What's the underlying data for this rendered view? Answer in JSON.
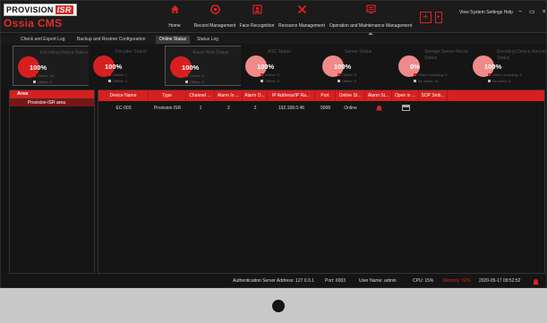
{
  "app": {
    "logo_text": "PROVISION",
    "logo_badge": "ISR",
    "logo_subtitle": "Ossia CMS"
  },
  "modules": [
    {
      "label": "Home",
      "icon": "home-icon"
    },
    {
      "label": "Record Management",
      "icon": "record-icon"
    },
    {
      "label": "Face Recognition",
      "icon": "face-recognition-icon"
    },
    {
      "label": "Resource Management",
      "icon": "tools-icon"
    },
    {
      "label": "Operation and Maintenance Management",
      "icon": "monitor-icon"
    }
  ],
  "header": {
    "plus_label": "+",
    "arrow_label": "▸",
    "sys_menu": "View System Settings Help",
    "win_controls": "− ▭ ×"
  },
  "tabs": [
    {
      "label": "Check and Export Log"
    },
    {
      "label": "Backup and Restore Configuration"
    },
    {
      "label": "Online Status",
      "active": true
    },
    {
      "label": "Status Log"
    }
  ],
  "cards": [
    {
      "title": "Encoding Device Status",
      "percent": "100%",
      "l1": "Online: 16",
      "l2": "Offline: 0",
      "color": "#d81f1f"
    },
    {
      "title": "Decoder Status",
      "percent": "100%",
      "l1": "Online: 1",
      "l2": "Offline: 0",
      "color": "#d81f1f"
    },
    {
      "title": "Alarm Host Status",
      "percent": "100%",
      "l1": "Online: 0",
      "l2": "Offline: 0",
      "color": "#d81f1f"
    },
    {
      "title": "ASC Status",
      "percent": "100%",
      "l1": "Online: 0",
      "l2": "Offline: 0",
      "color": "#ef8a8a"
    },
    {
      "title": "Server Status",
      "percent": "100%",
      "l1": "Online: 0",
      "l2": "Offline: 0",
      "color": "#ef8a8a"
    },
    {
      "title": "Storage Server Record Status",
      "percent": "0%",
      "l1": "Video recording: 0",
      "l2": "No video: 10",
      "color": "#ef8a8a"
    },
    {
      "title": "Encoding Device Record Status",
      "percent": "100%",
      "l1": "Video recording: 0",
      "l2": "No video: 0",
      "color": "#ef8a8a"
    }
  ],
  "area_panel": {
    "header": "Area",
    "items": [
      "Provision-ISR area"
    ]
  },
  "table": {
    "columns": [
      "Device Name",
      "Type",
      "Channel ...",
      "Alarm In ...",
      "Alarm O...",
      "IP Address/IP Ra...",
      "Port",
      "Online St...",
      "Alarm St...",
      "Open in ...",
      "SOP Setti..."
    ],
    "rows": [
      {
        "device_name": "EC-003",
        "type": "Provision ISR",
        "channel": "1",
        "alarm_in": "2",
        "alarm_out": "2",
        "ip": "192.168.0.46",
        "port": "9008",
        "online": "Online",
        "alarm_icon": "alarm-bell-icon",
        "open_icon": "window-icon",
        "sop": ""
      }
    ]
  },
  "statusbar": {
    "auth": "Authentication Server Address: 127.0.0.1",
    "port": "Port: 6003",
    "user": "User Name: admin",
    "cpu": "CPU: 15%",
    "memory": "Memory: 62%",
    "datetime": "2020-05-17 09:52:52"
  },
  "colors": {
    "accent": "#d81f1f",
    "accent_dark": "#7a1515",
    "card_alt": "#ef8a8a",
    "background": "#151515"
  }
}
